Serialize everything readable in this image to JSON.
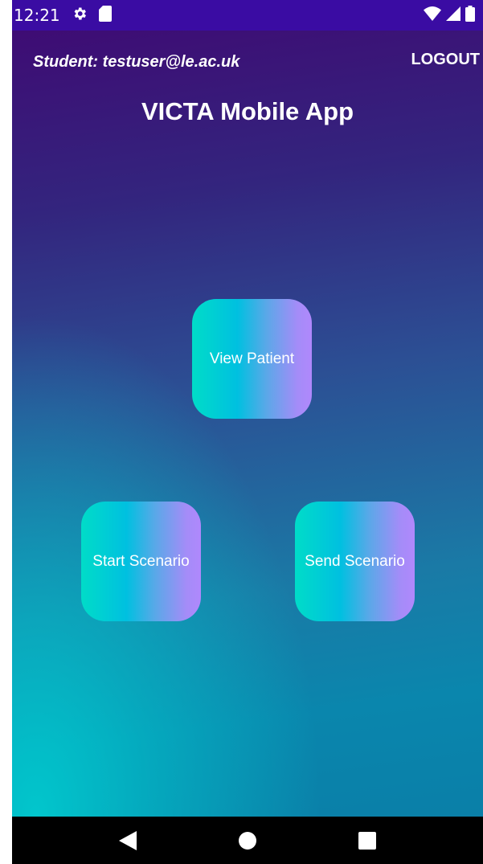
{
  "status_bar": {
    "time": "12:21",
    "left_icons": [
      "gear-icon",
      "sd-card-icon"
    ],
    "right_icons": [
      "wifi-icon",
      "signal-icon",
      "battery-icon"
    ],
    "background": "#3a0ca3"
  },
  "header": {
    "student_label": "Student: testuser@le.ac.uk",
    "logout_label": "LOGOUT"
  },
  "title": "VICTA Mobile App",
  "tiles": {
    "view_patient": "View Patient",
    "start_scenario": "Start Scenario",
    "send_scenario": "Send Scenario"
  },
  "nav_bar": {
    "buttons": [
      "back-icon",
      "home-icon",
      "recents-icon"
    ]
  },
  "colors": {
    "tile_gradient_start": "#00dcc8",
    "tile_gradient_end": "#b088fc",
    "screen_top": "#3e0c74",
    "screen_bottom": "#0a7fa8"
  }
}
